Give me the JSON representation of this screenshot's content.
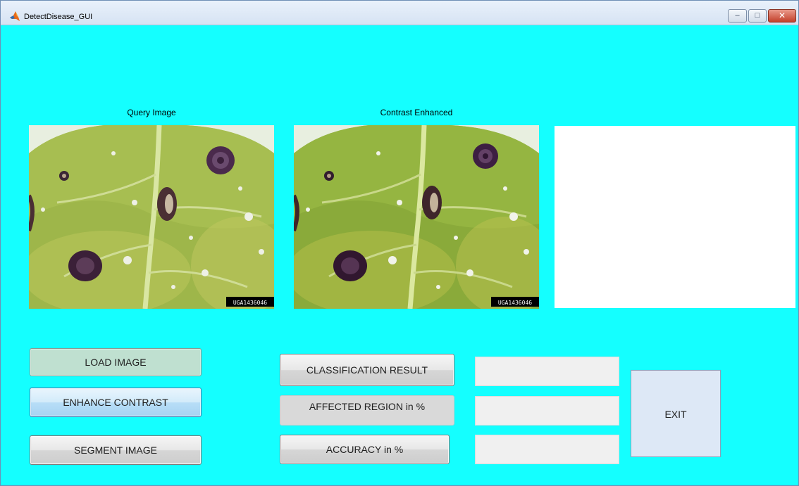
{
  "window": {
    "title": "DetectDisease_GUI",
    "controls": {
      "minimize_glyph": "–",
      "maximize_glyph": "□",
      "close_glyph": "✕"
    }
  },
  "icons": {
    "app": "matlab-logo-icon",
    "minimize": "minimize-icon",
    "maximize": "maximize-icon",
    "close": "close-icon"
  },
  "axes": {
    "query": {
      "label": "Query Image",
      "watermark": "UGA1436046"
    },
    "enhanced": {
      "label": "Contrast Enhanced",
      "watermark": "UGA1436046"
    }
  },
  "buttons": {
    "load": "LOAD IMAGE",
    "enhance": "ENHANCE CONTRAST",
    "segment": "SEGMENT IMAGE",
    "classification": "CLASSIFICATION RESULT",
    "affected": "AFFECTED REGION in %",
    "accuracy": "ACCURACY in %",
    "exit": "EXIT"
  },
  "fields": {
    "classification_value": "",
    "affected_value": "",
    "accuracy_value": ""
  },
  "colors": {
    "figure_background": "#14ffff",
    "load_button": "#bfe0d0",
    "enhance_button": "#b8def7"
  }
}
